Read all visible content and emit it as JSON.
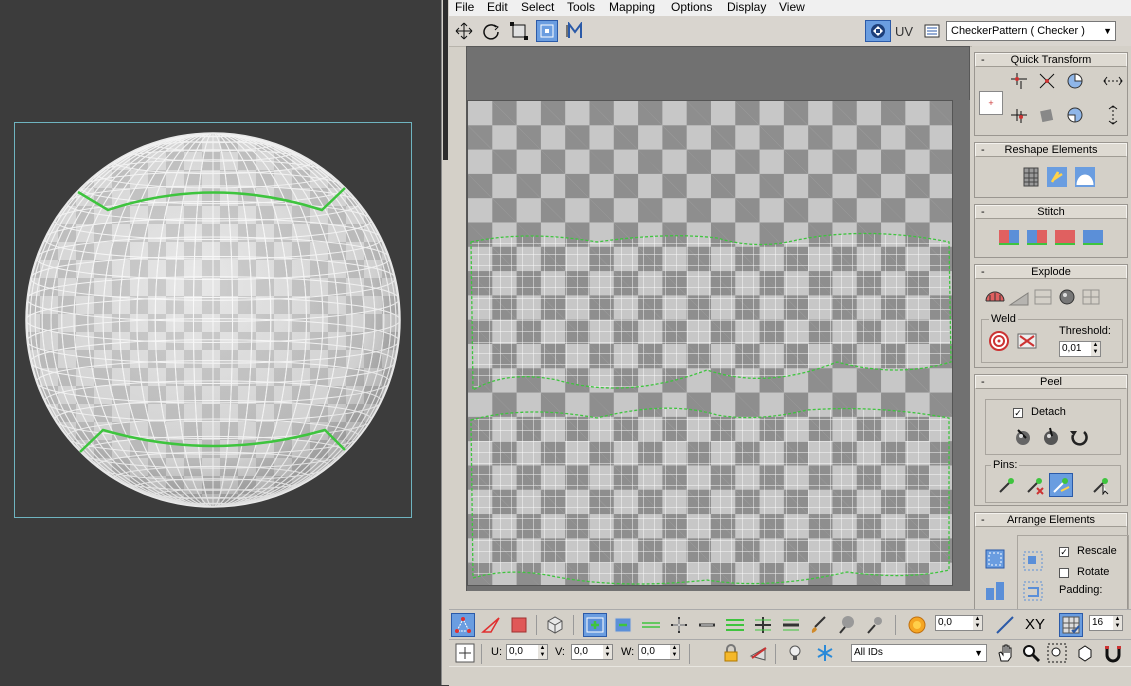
{
  "menubar": {
    "items": [
      "File",
      "Edit",
      "Select",
      "Tools",
      "Mapping",
      "Options",
      "Display",
      "View"
    ]
  },
  "toolbar": {
    "uv_label": "UV",
    "map_select": "CheckerPattern  ( Checker )"
  },
  "panel": {
    "quick_transform": {
      "title": "Quick Transform"
    },
    "reshape_elements": {
      "title": "Reshape Elements"
    },
    "stitch": {
      "title": "Stitch"
    },
    "explode": {
      "title": "Explode",
      "weld_label": "Weld",
      "threshold_label": "Threshold:",
      "threshold_value": "0,01"
    },
    "peel": {
      "title": "Peel",
      "detach_label": "Detach",
      "detach_checked": true,
      "pins_label": "Pins:"
    },
    "arrange_elements": {
      "title": "Arrange Elements",
      "rescale_label": "Rescale",
      "rescale_checked": true,
      "rotate_label": "Rotate",
      "rotate_checked": false,
      "padding_label": "Padding:"
    }
  },
  "bottom": {
    "soft_value": "0,0",
    "xy_label": "XY",
    "grid_value": "16",
    "u_label": "U:",
    "u_value": "0,0",
    "v_label": "V:",
    "v_value": "0,0",
    "w_label": "W:",
    "w_value": "0,0",
    "ids_select": "All IDs"
  },
  "colors": {
    "accent": "#6a9de0",
    "seam": "#3ec43e",
    "viewport_bg": "#3c3c3c",
    "panel_bg": "#d4d0c8"
  }
}
